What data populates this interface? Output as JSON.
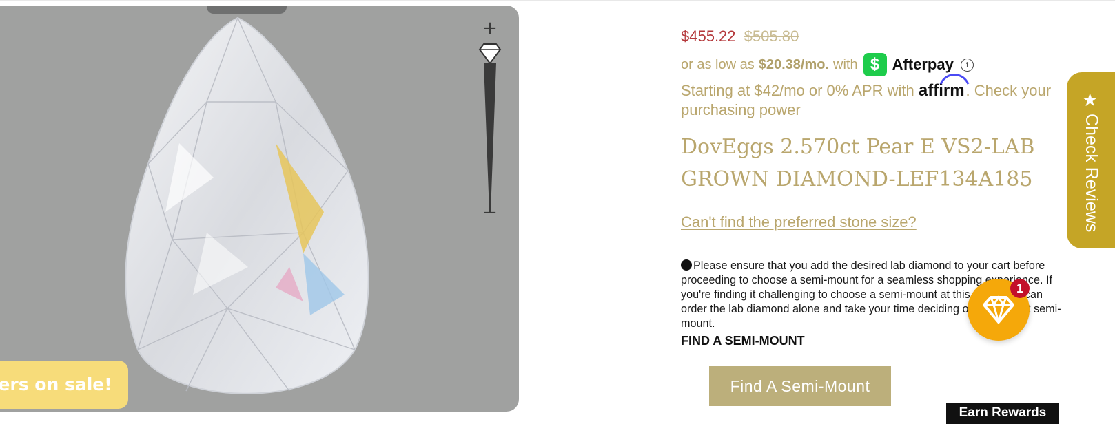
{
  "viewer": {
    "sale_banner": "offers on sale!",
    "zoom_in": "+",
    "zoom_out": "−"
  },
  "price": {
    "current": "$455.22",
    "original": "$505.80",
    "current_color": "#b4373a"
  },
  "afterpay": {
    "prefix": "or as low as",
    "amount": "$20.38/mo.",
    "with": "with",
    "cashapp_glyph": "$",
    "brand": "Afterpay",
    "info_glyph": "i"
  },
  "affirm": {
    "prefix": "Starting at $42/mo or 0% APR with",
    "brand": "affirm",
    "link": ". Check your purchasing power"
  },
  "product": {
    "title": "DovEggs 2.570ct Pear E VS2-LAB GROWN DIAMOND-LEF134A185"
  },
  "stone_size_link": "Can't find the preferred stone size?",
  "notice": {
    "text": "Please ensure that you add the desired lab diamond to your cart before proceeding to choose a semi-mount for a seamless shopping experience. If you're finding it challenging to choose a semi-mount at this point, you can order the lab diamond alone and take your time deciding on the perfect semi-mount.",
    "heading": "FIND A SEMI-MOUNT"
  },
  "find_button": "Find A Semi-Mount",
  "rewards_tab": "Earn Rewards",
  "reviews_tab": {
    "label": "Check Reviews",
    "icon": "star-icon",
    "color": "#c5a526"
  },
  "gem_widget": {
    "badge_count": "1",
    "icon": "diamond-icon",
    "color": "#f5a80a"
  },
  "theme": {
    "accent": "#b9a66d",
    "button_bg": "#bcaf7b"
  }
}
